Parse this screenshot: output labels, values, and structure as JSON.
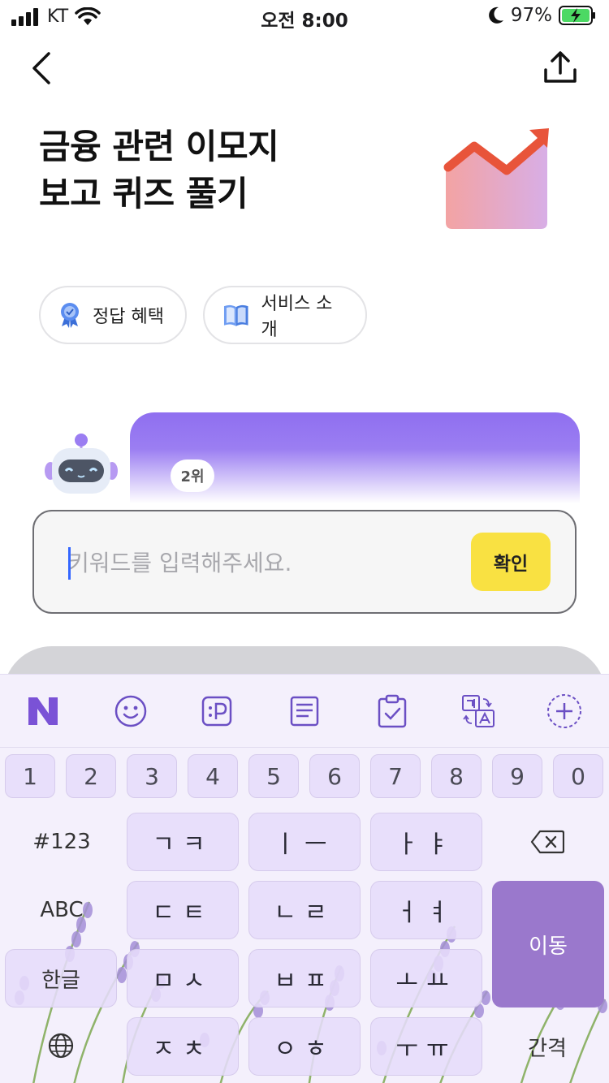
{
  "status_bar": {
    "carrier": "KT",
    "time": "오전 8:00",
    "battery": "97%"
  },
  "nav": {
    "back_icon": "chevron-left-icon",
    "share_icon": "share-upload-icon"
  },
  "header": {
    "title": "금융 관련 이모지\n보고 퀴즈 풀기",
    "hero_icon": "chart-trend-up-icon"
  },
  "chips": [
    {
      "label": "정답 혜택",
      "icon": "award-badge-icon"
    },
    {
      "label": "서비스 소개",
      "icon": "open-book-icon"
    }
  ],
  "card": {
    "rank": "2위",
    "mascot": "robot-icon"
  },
  "search": {
    "placeholder": "키워드를 입력해주세요.",
    "value": "",
    "confirm_label": "확인"
  },
  "keyboard": {
    "toolbar": [
      "naver-n-icon",
      "emoji-icon",
      "sticker-p-icon",
      "notes-icon",
      "clipboard-icon",
      "translate-icon",
      "add-circle-icon"
    ],
    "numbers": [
      "1",
      "2",
      "3",
      "4",
      "5",
      "6",
      "7",
      "8",
      "9",
      "0"
    ],
    "rows": [
      [
        "ㄱㅋ",
        "ㅣㅡ",
        "ㅏㅑ"
      ],
      [
        "ㄷㅌ",
        "ㄴㄹ",
        "ㅓㅕ"
      ],
      [
        "ㅁㅅ",
        "ㅂㅍ",
        "ㅗㅛ"
      ],
      [
        "ㅈㅊ",
        "ㅇㅎ",
        "ㅜㅠ"
      ]
    ],
    "side_left": [
      "#123",
      "ABC",
      "한글"
    ],
    "backspace_icon": "backspace-icon",
    "globe_icon": "globe-icon",
    "enter_label": "이동",
    "space_label": "간격"
  },
  "colors": {
    "accent_purple": "#8f6ff0",
    "confirm_yellow": "#f9e142",
    "chart_red": "#e8543a",
    "keyboard_enter": "#9a78cc"
  }
}
